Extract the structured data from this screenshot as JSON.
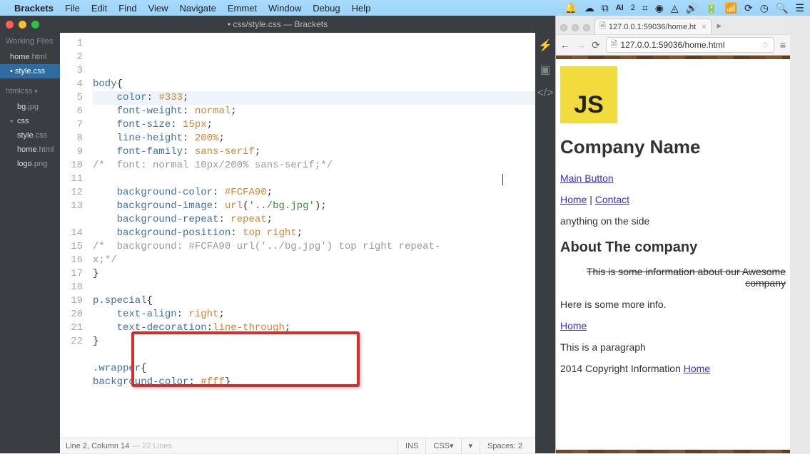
{
  "menubar": {
    "app": "Brackets",
    "items": [
      "File",
      "Edit",
      "Find",
      "View",
      "Navigate",
      "Emmet",
      "Window",
      "Debug",
      "Help"
    ]
  },
  "brackets": {
    "title": "• css/style.css — Brackets",
    "sidebar": {
      "working_header": "Working Files",
      "working": [
        {
          "name": "home",
          "ext": ".html"
        },
        {
          "name": "style",
          "ext": ".css"
        }
      ],
      "project_header": "htmlcss",
      "tree": [
        {
          "name": "bg",
          "ext": ".jpg",
          "indent": 1
        },
        {
          "name": "css",
          "ext": "",
          "indent": 0,
          "expanded": true
        },
        {
          "name": "style",
          "ext": ".css",
          "indent": 1
        },
        {
          "name": "home",
          "ext": ".html",
          "indent": 1
        },
        {
          "name": "logo",
          "ext": ".png",
          "indent": 1
        }
      ]
    },
    "lines": [
      {
        "n": 1,
        "t": [
          [
            "sel",
            "body"
          ],
          [
            "br",
            "{"
          ]
        ]
      },
      {
        "n": 2,
        "t": [
          [
            "in",
            "    "
          ],
          [
            "prop",
            "color"
          ],
          [
            "br",
            ": "
          ],
          [
            "val",
            "#333"
          ],
          [
            "br",
            ";"
          ]
        ],
        "hl": true
      },
      {
        "n": 3,
        "t": [
          [
            "in",
            "    "
          ],
          [
            "prop",
            "font-weight"
          ],
          [
            "br",
            ": "
          ],
          [
            "val",
            "normal"
          ],
          [
            "br",
            ";"
          ]
        ]
      },
      {
        "n": 4,
        "t": [
          [
            "in",
            "    "
          ],
          [
            "prop",
            "font-size"
          ],
          [
            "br",
            ": "
          ],
          [
            "val",
            "15px"
          ],
          [
            "br",
            ";"
          ]
        ]
      },
      {
        "n": 5,
        "t": [
          [
            "in",
            "    "
          ],
          [
            "prop",
            "line-height"
          ],
          [
            "br",
            ": "
          ],
          [
            "val",
            "200%"
          ],
          [
            "br",
            ";"
          ]
        ]
      },
      {
        "n": 6,
        "t": [
          [
            "in",
            "    "
          ],
          [
            "prop",
            "font-family"
          ],
          [
            "br",
            ": "
          ],
          [
            "val",
            "sans-serif"
          ],
          [
            "br",
            ";"
          ]
        ]
      },
      {
        "n": 7,
        "t": [
          [
            "com",
            "/*  font: normal 10px/200% sans-serif;*/"
          ]
        ]
      },
      {
        "n": 8,
        "t": []
      },
      {
        "n": 9,
        "t": [
          [
            "in",
            "    "
          ],
          [
            "prop",
            "background-color"
          ],
          [
            "br",
            ": "
          ],
          [
            "val",
            "#FCFA90"
          ],
          [
            "br",
            ";"
          ]
        ]
      },
      {
        "n": 10,
        "t": [
          [
            "in",
            "    "
          ],
          [
            "prop",
            "background-image"
          ],
          [
            "br",
            ": "
          ],
          [
            "val",
            "url"
          ],
          [
            "br",
            "("
          ],
          [
            "str",
            "'../bg.jpg'"
          ],
          [
            "br",
            ")"
          ],
          [
            "br",
            ";"
          ]
        ]
      },
      {
        "n": 11,
        "t": [
          [
            "in",
            "    "
          ],
          [
            "prop",
            "background-repeat"
          ],
          [
            "br",
            ": "
          ],
          [
            "val",
            "repeat"
          ],
          [
            "br",
            ";"
          ]
        ]
      },
      {
        "n": 12,
        "t": [
          [
            "in",
            "    "
          ],
          [
            "prop",
            "background-position"
          ],
          [
            "br",
            ": "
          ],
          [
            "val",
            "top right"
          ],
          [
            "br",
            ";"
          ]
        ]
      },
      {
        "n": 13,
        "t": [
          [
            "com",
            "/*  background: #FCFA90 url('../bg.jpg') top right repeat-x;*/"
          ]
        ],
        "wrap": true
      },
      {
        "n": 14,
        "t": [
          [
            "br",
            "}"
          ]
        ]
      },
      {
        "n": 15,
        "t": []
      },
      {
        "n": 16,
        "t": [
          [
            "sel",
            "p.special"
          ],
          [
            "br",
            "{"
          ]
        ]
      },
      {
        "n": 17,
        "t": [
          [
            "in",
            "    "
          ],
          [
            "prop",
            "text-align"
          ],
          [
            "br",
            ": "
          ],
          [
            "val",
            "right"
          ],
          [
            "br",
            ";"
          ]
        ]
      },
      {
        "n": 18,
        "t": [
          [
            "in",
            "    "
          ],
          [
            "prop",
            "text-decoration"
          ],
          [
            "br",
            ":"
          ],
          [
            "val",
            "line-through"
          ],
          [
            "br",
            ";"
          ]
        ]
      },
      {
        "n": 19,
        "t": [
          [
            "br",
            "}"
          ]
        ]
      },
      {
        "n": 20,
        "t": []
      },
      {
        "n": 21,
        "t": [
          [
            "sel",
            ".wrapper"
          ],
          [
            "br",
            "{"
          ]
        ]
      },
      {
        "n": 22,
        "t": [
          [
            "prop",
            "background-color"
          ],
          [
            "br",
            ": "
          ],
          [
            "val",
            "#fff"
          ],
          [
            "br",
            "}"
          ]
        ]
      }
    ],
    "status": {
      "left": "Line 2, Column 14",
      "dim": "— 22 Lines",
      "ins": "INS",
      "lang": "CSS",
      "enc": "▾",
      "spaces": "Spaces: 2"
    }
  },
  "browser": {
    "tab_title": "127.0.0.1:59036/home.ht",
    "url": "127.0.0.1:59036/home.html",
    "page": {
      "logo": "JS",
      "h1": "Company Name",
      "main_button": "Main Button",
      "nav_home": "Home",
      "nav_sep": " | ",
      "nav_contact": "Contact",
      "side_text": "anything on the side",
      "h2": "About The company",
      "special": "This is some information about our Awesome company",
      "more": "Here is some more info.",
      "link_home": "Home",
      "para": "This is a paragraph",
      "footer_pre": "2014 Copyright Information ",
      "footer_link": "Home"
    }
  }
}
